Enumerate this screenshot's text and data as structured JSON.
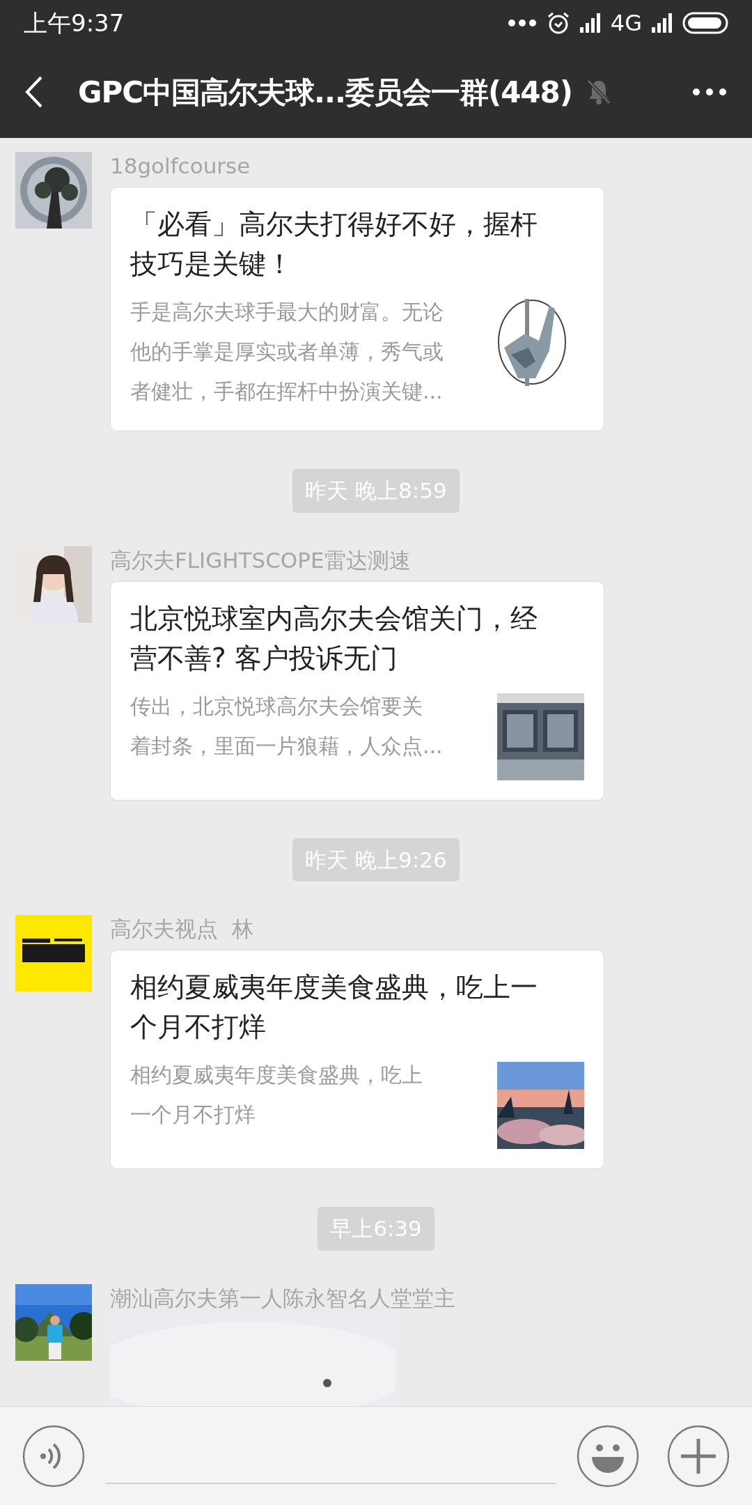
{
  "status_bar": {
    "time": "上午9:37",
    "network": "4G"
  },
  "header": {
    "title": "GPC中国高尔夫球...委员会一群(448)",
    "muted": true
  },
  "messages": [
    {
      "kind": "article",
      "sender": "18golfcourse",
      "title": "「必看」高尔夫打得好不好，握杆技巧是关键！",
      "summary_lines": [
        "手是高尔夫球手最大的财富。无论",
        "他的手掌是厚实或者单薄，秀气或",
        "者健壮，手都在挥杆中扮演关键..."
      ]
    },
    {
      "kind": "time",
      "text": "昨天 晚上8:59"
    },
    {
      "kind": "article",
      "sender": "高尔夫FLIGHTSCOPE雷达测速",
      "title": "北京悦球室内高尔夫会馆关门，经营不善? 客户投诉无门",
      "summary_lines": [
        "传出，北京悦球高尔夫会馆要关",
        "着封条，里面一片狼藉，人众点..."
      ]
    },
    {
      "kind": "time",
      "text": "昨天 晚上9:26"
    },
    {
      "kind": "article",
      "sender": "高尔夫视点  林",
      "title": "相约夏威夷年度美食盛典，吃上一个月不打烊",
      "summary_lines": [
        "相约夏威夷年度美食盛典，吃上",
        "一个月不打烊"
      ]
    },
    {
      "kind": "time",
      "text": "早上6:39"
    },
    {
      "sender": "潮汕高尔夫第一人陈永智名人堂堂主"
    }
  ]
}
